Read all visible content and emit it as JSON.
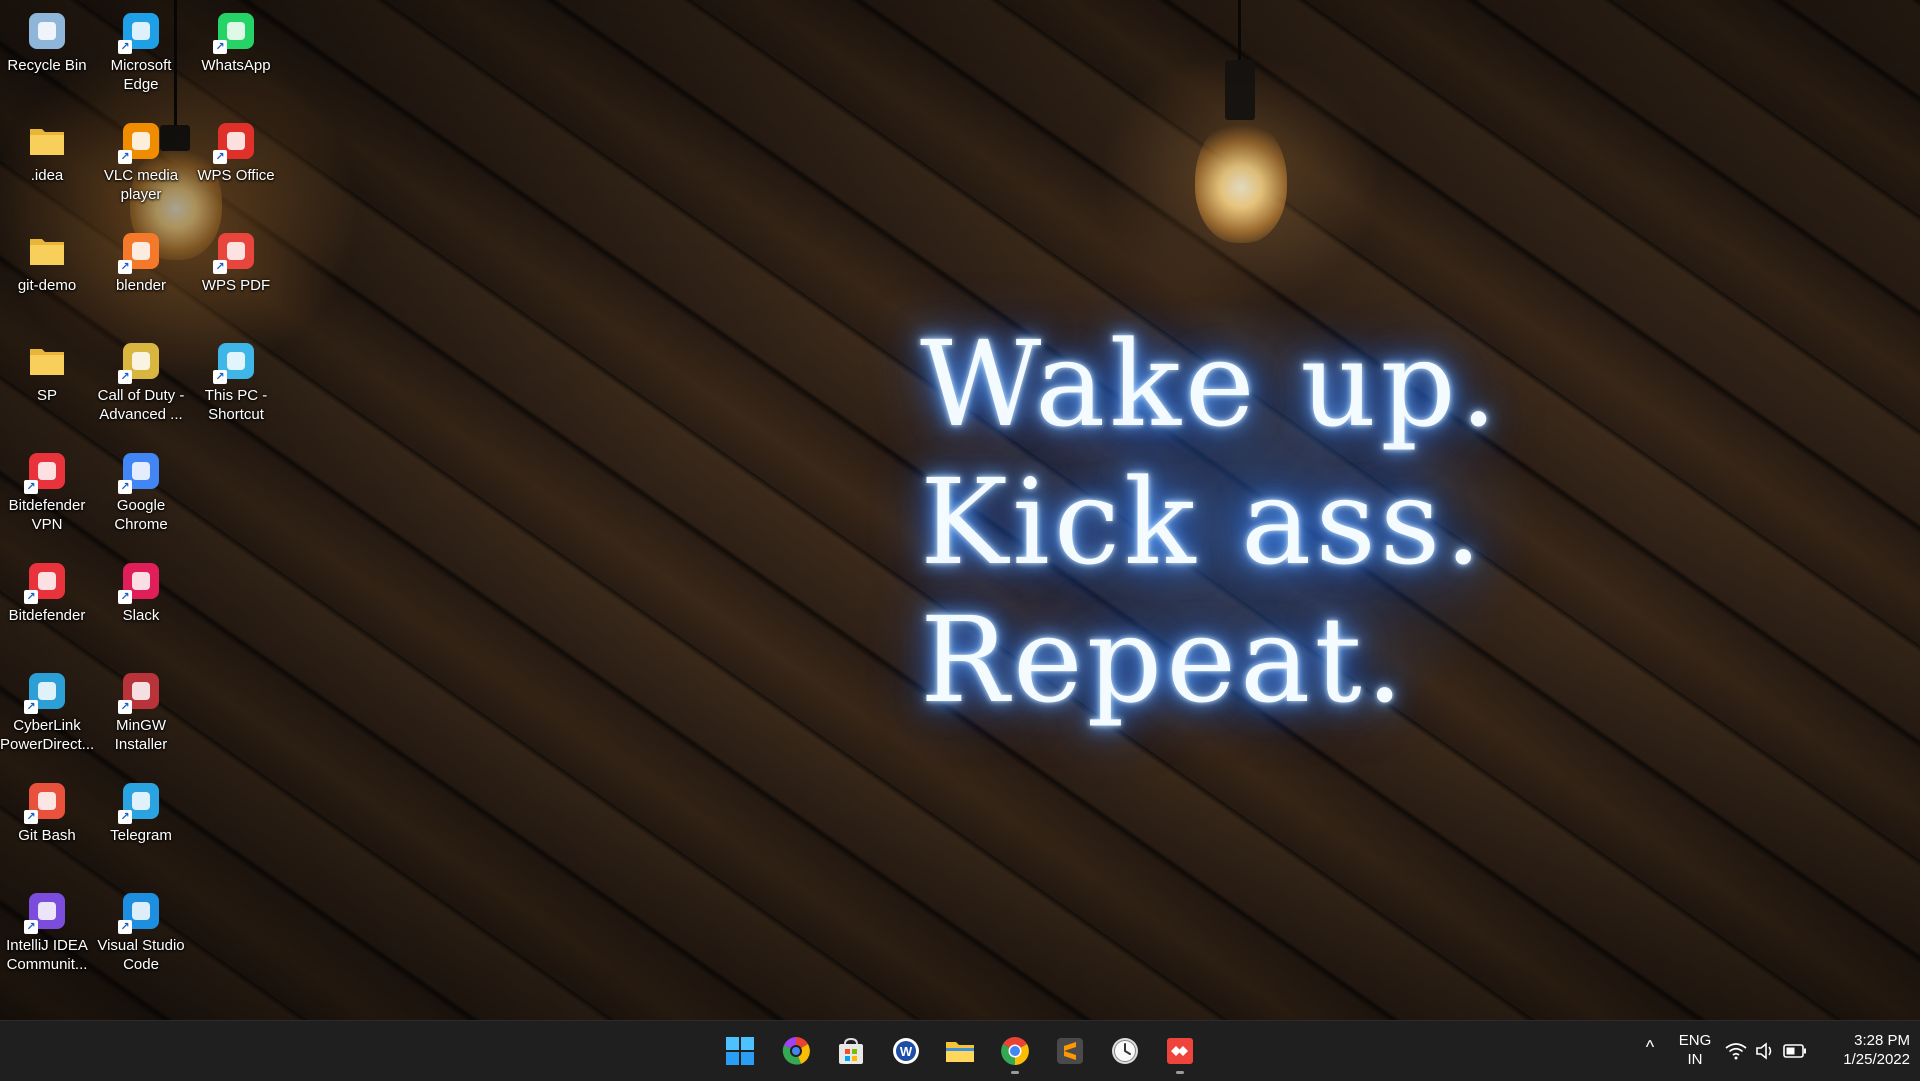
{
  "desktop": {
    "wallpaper_text": [
      "Wake up.",
      "Kick ass.",
      "Repeat."
    ],
    "icons": [
      {
        "label": "Recycle Bin",
        "icon": "recycle-bin-icon",
        "color": "#8fb6d9"
      },
      {
        "label": "Microsoft Edge",
        "icon": "edge-icon",
        "color": "#1fa0e6"
      },
      {
        "label": "WhatsApp",
        "icon": "whatsapp-icon",
        "color": "#25d366"
      },
      {
        "label": ".idea",
        "icon": "folder-icon",
        "color": "#f5c542"
      },
      {
        "label": "VLC media player",
        "icon": "vlc-icon",
        "color": "#f08c00"
      },
      {
        "label": "WPS Office",
        "icon": "wps-office-icon",
        "color": "#e0302a"
      },
      {
        "label": "git-demo",
        "icon": "folder-icon",
        "color": "#f5c542"
      },
      {
        "label": "blender",
        "icon": "blender-icon",
        "color": "#f5792a"
      },
      {
        "label": "WPS PDF",
        "icon": "wps-pdf-icon",
        "color": "#e8463c"
      },
      {
        "label": "SP",
        "icon": "folder-icon",
        "color": "#f5c542"
      },
      {
        "label": "Call of Duty - Advanced ...",
        "icon": "call-of-duty-icon",
        "color": "#d8b640"
      },
      {
        "label": "This PC - Shortcut",
        "icon": "this-pc-icon",
        "color": "#3fb6e8"
      },
      {
        "label": "Bitdefender VPN",
        "icon": "bitdefender-vpn-icon",
        "color": "#e8323c"
      },
      {
        "label": "Google Chrome",
        "icon": "chrome-icon",
        "color": "#4285f4"
      },
      {
        "label": "Bitdefender",
        "icon": "bitdefender-icon",
        "color": "#e8323c"
      },
      {
        "label": "Slack",
        "icon": "slack-icon",
        "color": "#e01e5a"
      },
      {
        "label": "CyberLink PowerDirect...",
        "icon": "cyberlink-icon",
        "color": "#2c9fd6"
      },
      {
        "label": "MinGW Installer",
        "icon": "mingw-icon",
        "color": "#b8343a"
      },
      {
        "label": "Git Bash",
        "icon": "git-bash-icon",
        "color": "#e8523c"
      },
      {
        "label": "Telegram",
        "icon": "telegram-icon",
        "color": "#2aa3e0"
      },
      {
        "label": "IntelliJ IDEA Communit...",
        "icon": "intellij-icon",
        "color": "#7c4ddc"
      },
      {
        "label": "Visual Studio Code",
        "icon": "vscode-icon",
        "color": "#1e8fe0"
      }
    ]
  },
  "taskbar": {
    "apps": [
      {
        "name": "start-button",
        "icon": "windows-start-icon"
      },
      {
        "name": "taskbar-app-chrome-canary",
        "icon": "chrome-colorful-icon"
      },
      {
        "name": "taskbar-app-store",
        "icon": "microsoft-store-icon"
      },
      {
        "name": "taskbar-app-w",
        "icon": "w-circle-icon"
      },
      {
        "name": "taskbar-app-file-explorer",
        "icon": "file-explorer-icon"
      },
      {
        "name": "taskbar-app-chrome",
        "icon": "chrome-icon"
      },
      {
        "name": "taskbar-app-sublime",
        "icon": "sublime-text-icon"
      },
      {
        "name": "taskbar-app-clock",
        "icon": "clock-icon"
      },
      {
        "name": "taskbar-app-anydesk",
        "icon": "anydesk-icon"
      }
    ],
    "tray": {
      "overflow_glyph": "^",
      "lang_top": "ENG",
      "lang_bottom": "IN",
      "time": "3:28 PM",
      "date": "1/25/2022"
    }
  }
}
